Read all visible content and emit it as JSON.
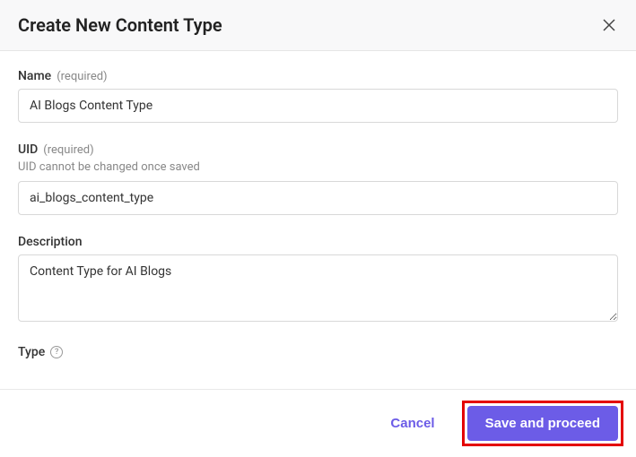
{
  "header": {
    "title": "Create New Content Type"
  },
  "fields": {
    "name": {
      "label": "Name",
      "required_tag": "(required)",
      "value": "AI Blogs Content Type"
    },
    "uid": {
      "label": "UID",
      "required_tag": "(required)",
      "hint": "UID cannot be changed once saved",
      "value": "ai_blogs_content_type"
    },
    "description": {
      "label": "Description",
      "value": "Content Type for AI Blogs"
    },
    "type": {
      "label": "Type"
    }
  },
  "footer": {
    "cancel_label": "Cancel",
    "save_label": "Save and proceed"
  }
}
